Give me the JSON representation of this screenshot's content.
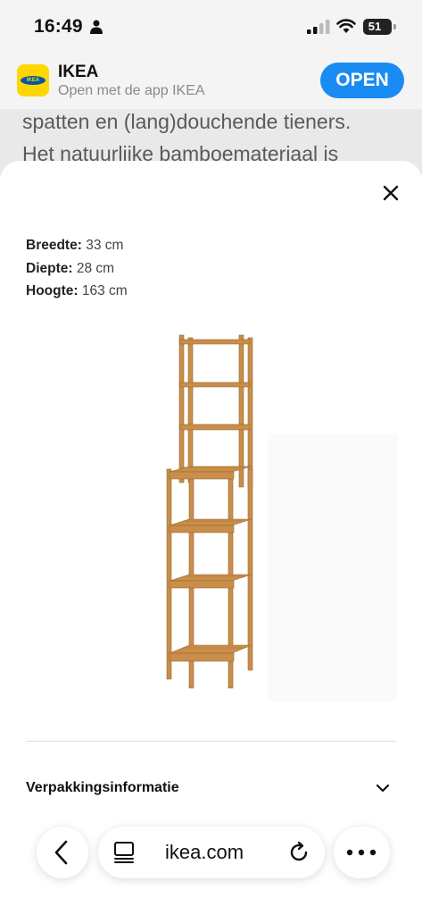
{
  "status_bar": {
    "time": "16:49",
    "battery": "51"
  },
  "app_banner": {
    "app_name": "IKEA",
    "subtitle": "Open met de app IKEA",
    "open_label": "OPEN",
    "logo_text": "IKEA"
  },
  "background_text": {
    "line1": "spatten en (lang)douchende tieners.",
    "line2": "Het natuurlijke bamboemateriaal is"
  },
  "sheet": {
    "specs": [
      {
        "label": "Breedte:",
        "value": "33 cm"
      },
      {
        "label": "Diepte:",
        "value": "28 cm"
      },
      {
        "label": "Hoogte:",
        "value": "163 cm"
      }
    ],
    "packaging_label": "Verpakkingsinformatie"
  },
  "browser_bar": {
    "url": "ikea.com"
  },
  "colors": {
    "accent": "#1a8bf2",
    "ikea_yellow": "#ffd700",
    "ikea_blue": "#0058a3",
    "bamboo": "#c98e4a"
  }
}
